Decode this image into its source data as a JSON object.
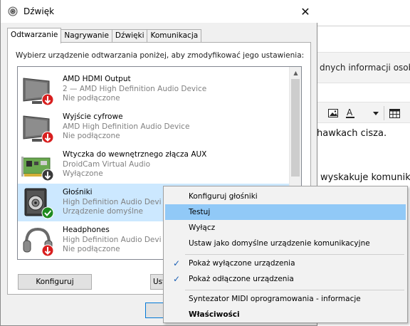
{
  "background_doc": {
    "ribbon_text": "dnych informacji osobi",
    "text_line1": "hawkach cisza.",
    "text_line2": "wyskakuje komunik"
  },
  "dialog": {
    "title": "Dźwięk",
    "close_glyph": "✕",
    "tabs": [
      "Odtwarzanie",
      "Nagrywanie",
      "Dźwięki",
      "Komunikacja"
    ],
    "instruction": "Wybierz urządzenie odtwarzania poniżej, aby zmodyfikować jego ustawienia:",
    "devices": [
      {
        "name": "AMD HDMI Output",
        "line2": "2 — AMD High Definition Audio Device",
        "line3": "Nie podłączone",
        "icon": "monitor-icon",
        "status": "disconnected"
      },
      {
        "name": "Wyjście cyfrowe",
        "line2": "AMD High Definition Audio Device",
        "line3": "Nie podłączone",
        "icon": "monitor-icon",
        "status": "disconnected"
      },
      {
        "name": "Wtyczka do wewnętrznego złącza AUX",
        "line2": "DroidCam Virtual Audio",
        "line3": "Wyłączone",
        "icon": "sound-card-icon",
        "status": "disabled"
      },
      {
        "name": "Głośniki",
        "line2": "High Definition Audio Devi",
        "line3": "Urządzenie domyślne",
        "icon": "speaker-icon",
        "status": "default"
      },
      {
        "name": "Headphones",
        "line2": "High Definition Audio Devi",
        "line3": "Nie podłączone",
        "icon": "headphones-icon",
        "status": "disconnected"
      }
    ],
    "buttons": {
      "configure": "Konfiguruj",
      "set_default_partial": "Ust"
    }
  },
  "context_menu": {
    "items": [
      {
        "label": "Konfiguruj głośniki",
        "checked": false,
        "bold": false
      },
      {
        "label": "Testuj",
        "checked": false,
        "bold": false,
        "highlighted": true
      },
      {
        "label": "Wyłącz",
        "checked": false,
        "bold": false
      },
      {
        "label": "Ustaw jako domyślne urządzenie komunikacyjne",
        "checked": false,
        "bold": false
      },
      {
        "label": "Pokaż wyłączone urządzenia",
        "checked": true,
        "bold": false
      },
      {
        "label": "Pokaż odłączone urządzenia",
        "checked": true,
        "bold": false
      },
      {
        "label": "Syntezator MIDI oprogramowania - informacje",
        "checked": false,
        "bold": false
      },
      {
        "label": "Właściwości",
        "checked": false,
        "bold": true
      }
    ],
    "check_glyph": "✓"
  },
  "colors": {
    "selection": "#cce8ff",
    "menu_highlight": "#91c9f7",
    "status_red": "#d81e1e",
    "status_green": "#1e8a1e"
  }
}
